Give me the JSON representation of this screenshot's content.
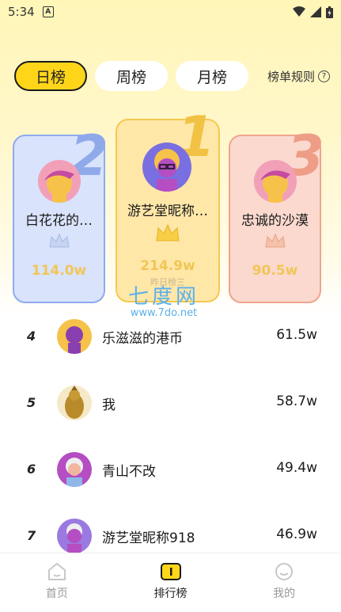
{
  "status_bar": {
    "time": "5:34",
    "a_badge": "A"
  },
  "tabs": [
    {
      "label": "日榜",
      "active": true
    },
    {
      "label": "周榜",
      "active": false
    },
    {
      "label": "月榜",
      "active": false
    }
  ],
  "rules_label": "榜单规则",
  "podium": [
    {
      "rank": "2",
      "name": "白花花的…",
      "score": "114.0w",
      "note": ""
    },
    {
      "rank": "1",
      "name": "游艺堂昵称…",
      "score": "214.9w",
      "note": "昨日榜三"
    },
    {
      "rank": "3",
      "name": "忠诚的沙漠",
      "score": "90.5w",
      "note": ""
    }
  ],
  "watermark": {
    "line1": "七度网",
    "line2": "www.7do.net"
  },
  "list": [
    {
      "rank": "4",
      "name": "乐滋滋的港币",
      "score": "61.5w"
    },
    {
      "rank": "5",
      "name": "我",
      "score": "58.7w"
    },
    {
      "rank": "6",
      "name": "青山不改",
      "score": "49.4w"
    },
    {
      "rank": "7",
      "name": "游艺堂昵称918",
      "score": "46.9w"
    }
  ],
  "bottom_nav": [
    {
      "label": "首页",
      "icon": "home-icon",
      "active": false
    },
    {
      "label": "排行榜",
      "icon": "ranking-icon",
      "active": true
    },
    {
      "label": "我的",
      "icon": "profile-icon",
      "active": false
    }
  ],
  "colors": {
    "accent": "#ffd51a",
    "rank2": "#8fa9ea",
    "rank1": "#f1c243",
    "rank3": "#ee9d86"
  }
}
